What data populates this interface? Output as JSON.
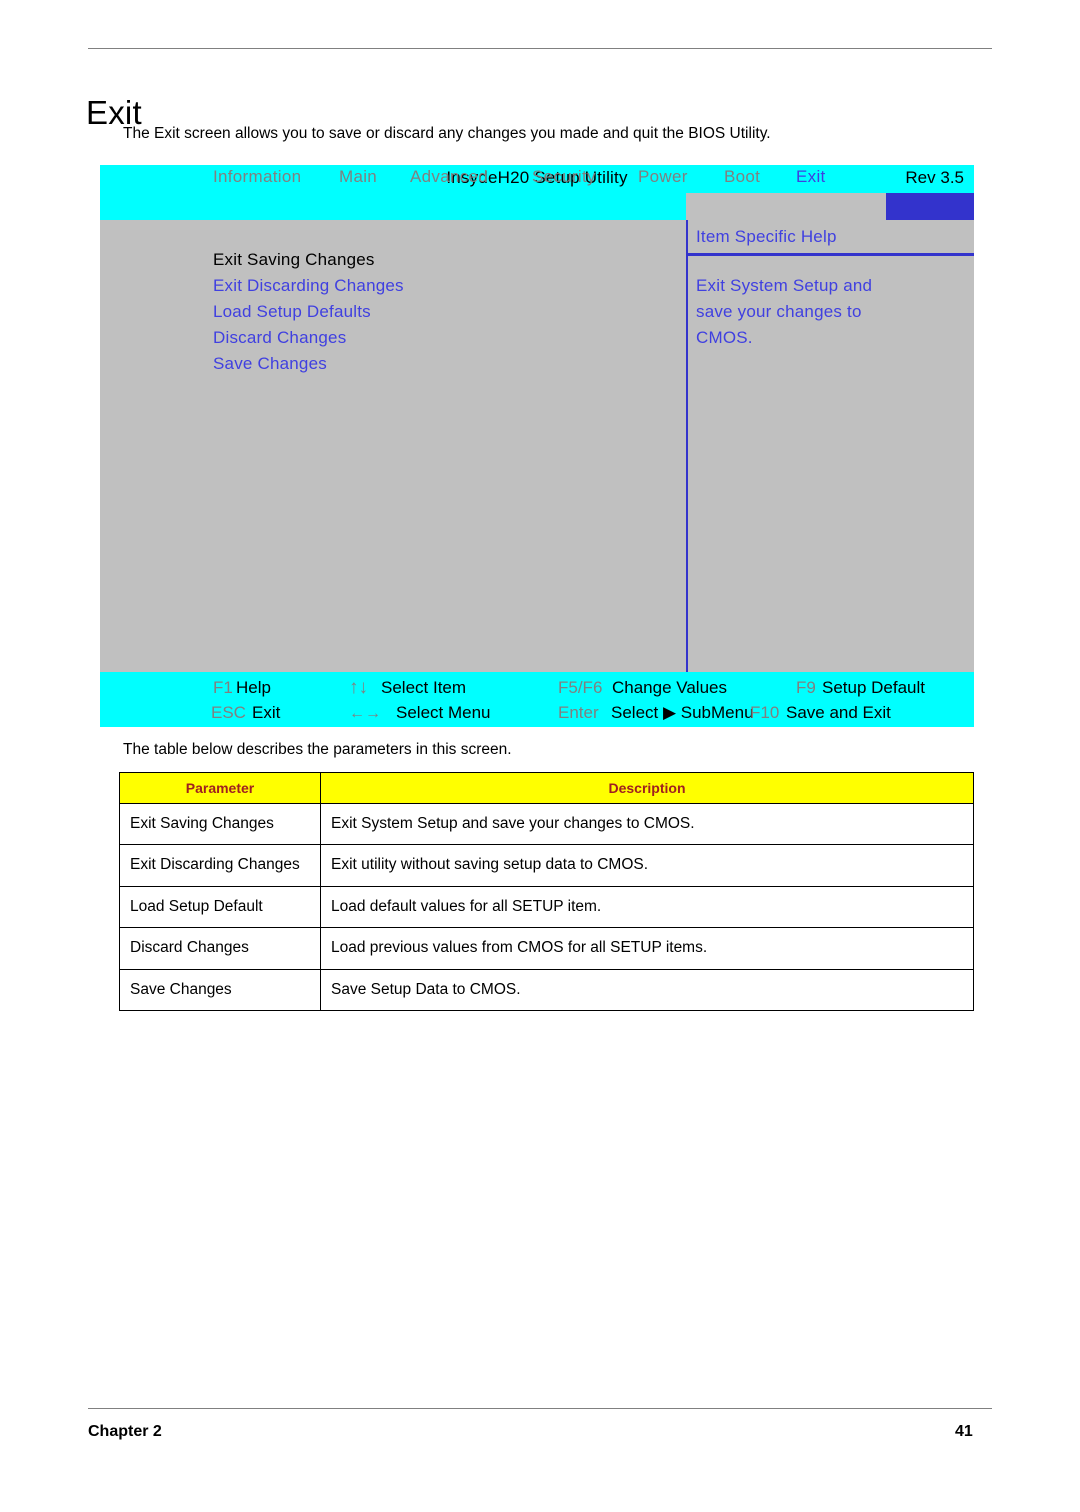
{
  "document": {
    "heading": "Exit",
    "intro": "The Exit screen allows you to save or discard any changes you made and quit the BIOS Utility.",
    "table_intro": "The table below describes the parameters in this screen.",
    "footer_chapter": "Chapter 2",
    "footer_page": "41"
  },
  "bios": {
    "title": "InsydeH20 Setup Utility",
    "rev": "Rev 3.5",
    "menu": [
      {
        "label": "Information",
        "selected": false
      },
      {
        "label": "Main",
        "selected": false
      },
      {
        "label": "Advanced",
        "selected": false
      },
      {
        "label": "Security",
        "selected": false
      },
      {
        "label": "Power",
        "selected": false
      },
      {
        "label": "Boot",
        "selected": false
      },
      {
        "label": "Exit",
        "selected": true
      }
    ],
    "options": [
      {
        "label": "Exit Saving Changes",
        "state": "highlight"
      },
      {
        "label": "Exit Discarding Changes",
        "state": "normal"
      },
      {
        "label": "Load Setup Defaults",
        "state": "normal"
      },
      {
        "label": "Discard Changes",
        "state": "normal"
      },
      {
        "label": "Save Changes",
        "state": "normal"
      }
    ],
    "help": {
      "title": "Item Specific Help",
      "lines": [
        "Exit System Setup and",
        "save your changes to",
        "CMOS."
      ]
    },
    "footer_keys": [
      {
        "key": "F1",
        "label": "Help"
      },
      {
        "key": "↑↓",
        "label": "Select Item"
      },
      {
        "key": "F5/F6",
        "label": "Change Values"
      },
      {
        "key": "F9",
        "label": "Setup Default"
      },
      {
        "key": "ESC",
        "label": "Exit"
      },
      {
        "key": "←→",
        "label": "Select Menu"
      },
      {
        "key": "Enter",
        "label": "Select ▶ SubMenu"
      },
      {
        "key": "F10",
        "label": "Save and Exit"
      }
    ]
  },
  "table": {
    "headers": [
      "Parameter",
      "Description"
    ],
    "rows": [
      {
        "parameter": "Exit Saving Changes",
        "description": "Exit System Setup and save your changes to CMOS."
      },
      {
        "parameter": "Exit Discarding Changes",
        "description": "Exit utility without saving setup data to CMOS."
      },
      {
        "parameter": "Load Setup Default",
        "description": "Load default values for all SETUP item."
      },
      {
        "parameter": "Discard Changes",
        "description": "Load previous values from CMOS for all SETUP items."
      },
      {
        "parameter": "Save Changes",
        "description": "Save Setup Data to CMOS."
      }
    ]
  }
}
